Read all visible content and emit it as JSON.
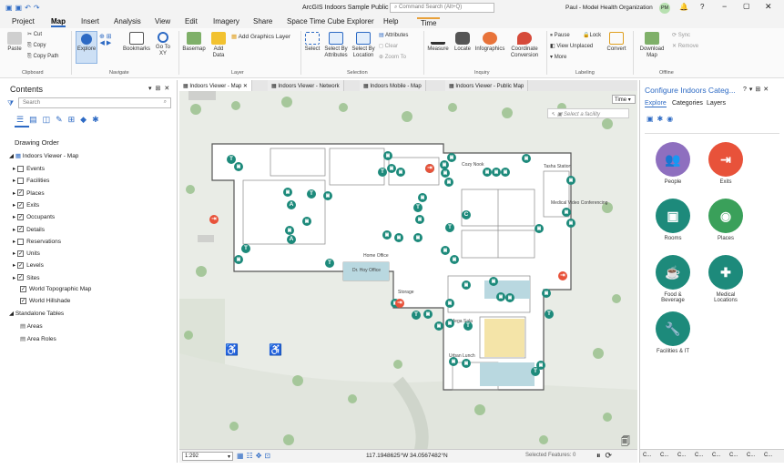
{
  "titlebar": {
    "title": "ArcGIS Indoors Sample Public",
    "search_placeholder": "Command Search (Alt+Q)",
    "user": "Paul - Model Health Organization",
    "initials": "PM"
  },
  "tabs": [
    "Project",
    "Map",
    "Insert",
    "Analysis",
    "View",
    "Edit",
    "Imagery",
    "Share",
    "Space Time Cube Explorer",
    "Help",
    "Time"
  ],
  "ribbon": {
    "groups": [
      "Clipboard",
      "Navigate",
      "Layer",
      "Selection",
      "Inquiry",
      "Labeling",
      "Offline"
    ],
    "clipboard": [
      "Paste",
      "Cut",
      "Copy",
      "Copy Path"
    ],
    "navigate": [
      "Explore",
      "Bookmarks",
      "Go To XY"
    ],
    "layer": [
      "Basemap",
      "Add Data",
      "Add Graphics Layer"
    ],
    "selection": [
      "Select",
      "Select By Attributes",
      "Select By Location",
      "Attributes",
      "Clear",
      "Zoom To"
    ],
    "inquiry": [
      "Measure",
      "Locate",
      "Infographics",
      "Coordinate Conversion"
    ],
    "labeling": [
      "Pause",
      "Lock",
      "View Unplaced",
      "More",
      "Convert"
    ],
    "offline": [
      "Download Map",
      "Sync",
      "Remove"
    ]
  },
  "contents": {
    "title": "Contents",
    "search_placeholder": "Search",
    "section": "Drawing Order",
    "map": "Indoors Viewer - Map",
    "layers": [
      {
        "name": "Events",
        "checked": false
      },
      {
        "name": "Facilities",
        "checked": false
      },
      {
        "name": "Places",
        "checked": true
      },
      {
        "name": "Exits",
        "checked": true
      },
      {
        "name": "Occupants",
        "checked": true
      },
      {
        "name": "Details",
        "checked": true
      },
      {
        "name": "Reservations",
        "checked": false
      },
      {
        "name": "Units",
        "checked": true
      },
      {
        "name": "Levels",
        "checked": true
      },
      {
        "name": "Sites",
        "checked": true
      },
      {
        "name": "World Topographic Map",
        "checked": true
      },
      {
        "name": "World Hillshade",
        "checked": true
      }
    ],
    "standalone": "Standalone Tables",
    "tables": [
      "Areas",
      "Area Roles"
    ]
  },
  "doctabs": [
    "Indoors Viewer - Map",
    "Indoors Viewer - Network",
    "Indoors Mobile - Map",
    "Indoors Viewer - Public Map"
  ],
  "map": {
    "time_label": "Time",
    "select_hint": "Select a facility",
    "labels": [
      "Cozy Nook",
      "Home Office",
      "Tasha Station",
      "Medical Video Conferencing",
      "Dr. Hoy Office",
      "Storage",
      "Mega Sala",
      "Urban Lunch"
    ]
  },
  "config": {
    "title": "Configure Indoors Categ...",
    "tabs": [
      "Explore",
      "Categories",
      "Layers"
    ],
    "categories": [
      {
        "name": "People",
        "color": "#8e6fbf"
      },
      {
        "name": "Exits",
        "color": "#e8523a"
      },
      {
        "name": "Rooms",
        "color": "#1d8a7b"
      },
      {
        "name": "Places",
        "color": "#3aa05a"
      },
      {
        "name": "Food & Beverage",
        "color": "#1d8a7b"
      },
      {
        "name": "Medical Locations",
        "color": "#1d8a7b"
      },
      {
        "name": "Facilities & IT",
        "color": "#1d8a7b"
      }
    ],
    "bottom_tabs": [
      "C...",
      "C...",
      "C...",
      "C...",
      "C...",
      "C...",
      "C...",
      "C..."
    ]
  },
  "status": {
    "scale": "1:292",
    "coords": "117.1948625°W 34.0567482°N",
    "selected": "Selected Features: 0"
  }
}
